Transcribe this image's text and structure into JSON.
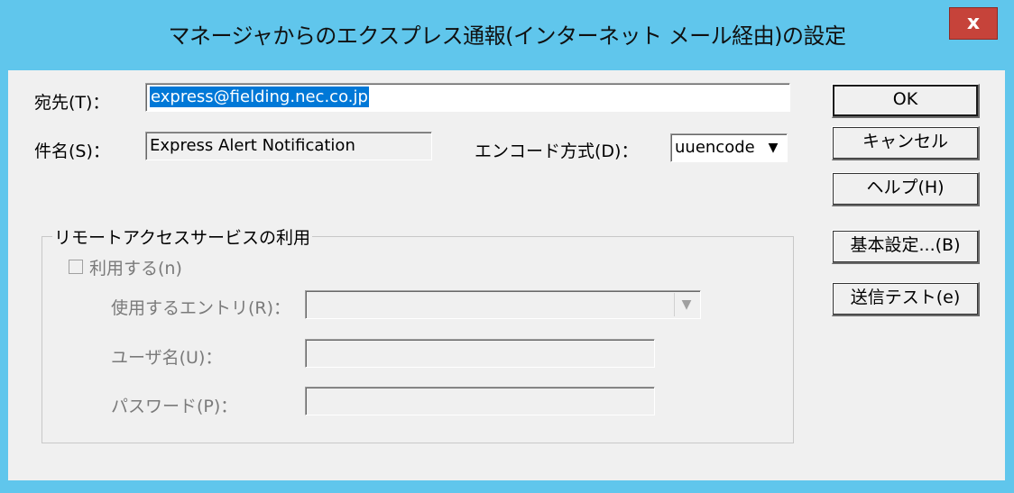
{
  "window": {
    "title": "マネージャからのエクスプレス通報(インターネット メール経由)の設定",
    "close_label": "x"
  },
  "form": {
    "to_label": "宛先(T)：",
    "to_value": "express@fielding.nec.co.jp",
    "subject_label": "件名(S)：",
    "subject_value": "Express Alert Notification",
    "encode_label": "エンコード方式(D)：",
    "encode_value": "uuencode"
  },
  "buttons": {
    "ok": "OK",
    "cancel": "キャンセル",
    "help": "ヘルプ(H)",
    "basic_settings": "基本設定...(B)",
    "send_test": "送信テスト(e)"
  },
  "remote_access": {
    "group_title": "リモートアクセスサービスの利用",
    "use_label": "利用する(n)",
    "use_checked": false,
    "entry_label": "使用するエントリ(R)：",
    "entry_value": "",
    "user_label": "ユーザ名(U)：",
    "user_value": "",
    "password_label": "パスワード(P)：",
    "password_value": ""
  },
  "colors": {
    "title_bar": "#60c6ec",
    "close_button": "#c6433a",
    "selection": "#0078d7",
    "dialog_bg": "#f0f0f0"
  }
}
